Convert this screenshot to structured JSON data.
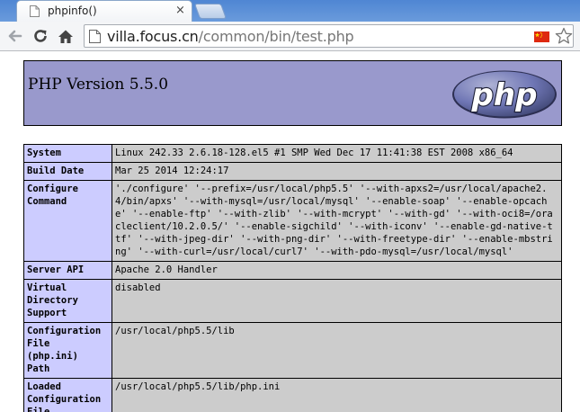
{
  "browser": {
    "tab": {
      "title": "phpinfo()",
      "close_glyph": "×"
    },
    "address": {
      "host": "villa.focus.cn",
      "path": "/common/bin/test.php"
    },
    "icons": [
      "back-icon",
      "reload-icon",
      "home-icon",
      "page-icon",
      "china-flag-icon",
      "bookmark-star-icon"
    ]
  },
  "php": {
    "version_title": "PHP Version 5.5.0",
    "logo_text": "php",
    "rows": [
      {
        "key": "System",
        "value": "Linux 242.33 2.6.18-128.el5 #1 SMP Wed Dec 17 11:41:38 EST 2008 x86_64"
      },
      {
        "key": "Build Date",
        "value": "Mar 25 2014 12:24:17"
      },
      {
        "key": "Configure\nCommand",
        "value": "'./configure' '--prefix=/usr/local/php5.5' '--with-apxs2=/usr/local/apache2.4/bin/apxs' '--with-mysql=/usr/local/mysql' '--enable-soap' '--enable-opcache' '--enable-ftp' '--with-zlib' '--with-mcrypt' '--with-gd' '--with-oci8=/oracleclient/10.2.0.5/' '--enable-sigchild' '--with-iconv' '--enable-gd-native-ttf' '--with-jpeg-dir' '--with-png-dir' '--with-freetype-dir' '--enable-mbstring' '--with-curl=/usr/local/curl7' '--with-pdo-mysql=/usr/local/mysql'"
      },
      {
        "key": "Server API",
        "value": "Apache 2.0 Handler"
      },
      {
        "key": "Virtual\nDirectory\nSupport",
        "value": "disabled"
      },
      {
        "key": "Configuration\nFile\n(php.ini)\nPath",
        "value": "/usr/local/php5.5/lib"
      },
      {
        "key": "Loaded\nConfiguration\nFile",
        "value": "/usr/local/php5.5/lib/php.ini"
      }
    ]
  },
  "colors": {
    "header_bg": "#9999cc",
    "key_bg": "#ccccff",
    "value_bg": "#cccccc",
    "tabstrip": "#5b8fd6"
  }
}
